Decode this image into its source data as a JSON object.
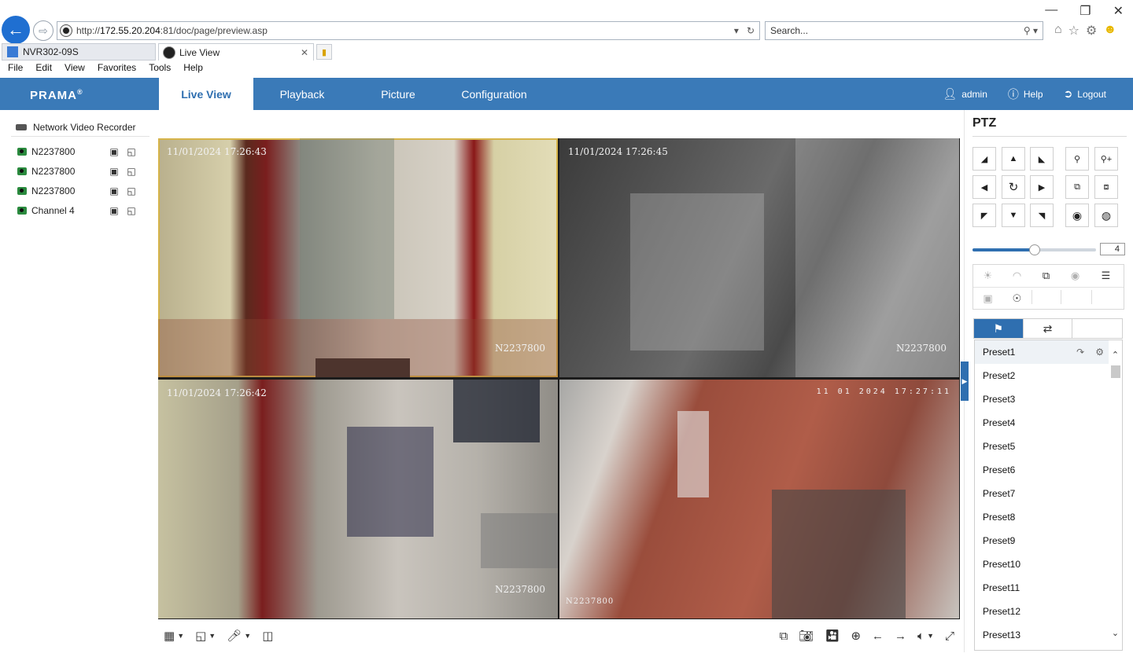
{
  "browser": {
    "url_prefix": "http://",
    "url_host": "172.55.20.204",
    "url_path": ":81/doc/page/preview.asp",
    "search_placeholder": "Search...",
    "tabs": [
      {
        "label": "NVR302-09S"
      },
      {
        "label": "Live View"
      }
    ],
    "menu": [
      "File",
      "Edit",
      "View",
      "Favorites",
      "Tools",
      "Help"
    ]
  },
  "app": {
    "logo": "PRAMA",
    "nav": [
      "Live View",
      "Playback",
      "Picture",
      "Configuration"
    ],
    "active_nav": "Live View",
    "user": "admin",
    "help": "Help",
    "logout": "Logout",
    "accent": "#3a7ab8"
  },
  "tree": {
    "root": "Network Video Recorder",
    "channels": [
      {
        "name": "N2237800"
      },
      {
        "name": "N2237800"
      },
      {
        "name": "N2237800"
      },
      {
        "name": "Channel 4"
      }
    ]
  },
  "tiles": [
    {
      "timestamp": "11/01/2024  17:26:43",
      "camera": "N2237800",
      "selected": true
    },
    {
      "timestamp": "11/01/2024  17:26:45",
      "camera": "N2237800"
    },
    {
      "timestamp": "11/01/2024  17:26:42",
      "camera": "N2237800"
    },
    {
      "timestamp": "11 01 2024  17:27:11",
      "camera": "N2237800"
    }
  ],
  "ptz": {
    "title": "PTZ",
    "speed": "4",
    "speed_level": 0.5,
    "presets": [
      "Preset1",
      "Preset2",
      "Preset3",
      "Preset4",
      "Preset5",
      "Preset6",
      "Preset7",
      "Preset8",
      "Preset9",
      "Preset10",
      "Preset11",
      "Preset12",
      "Preset13"
    ]
  }
}
